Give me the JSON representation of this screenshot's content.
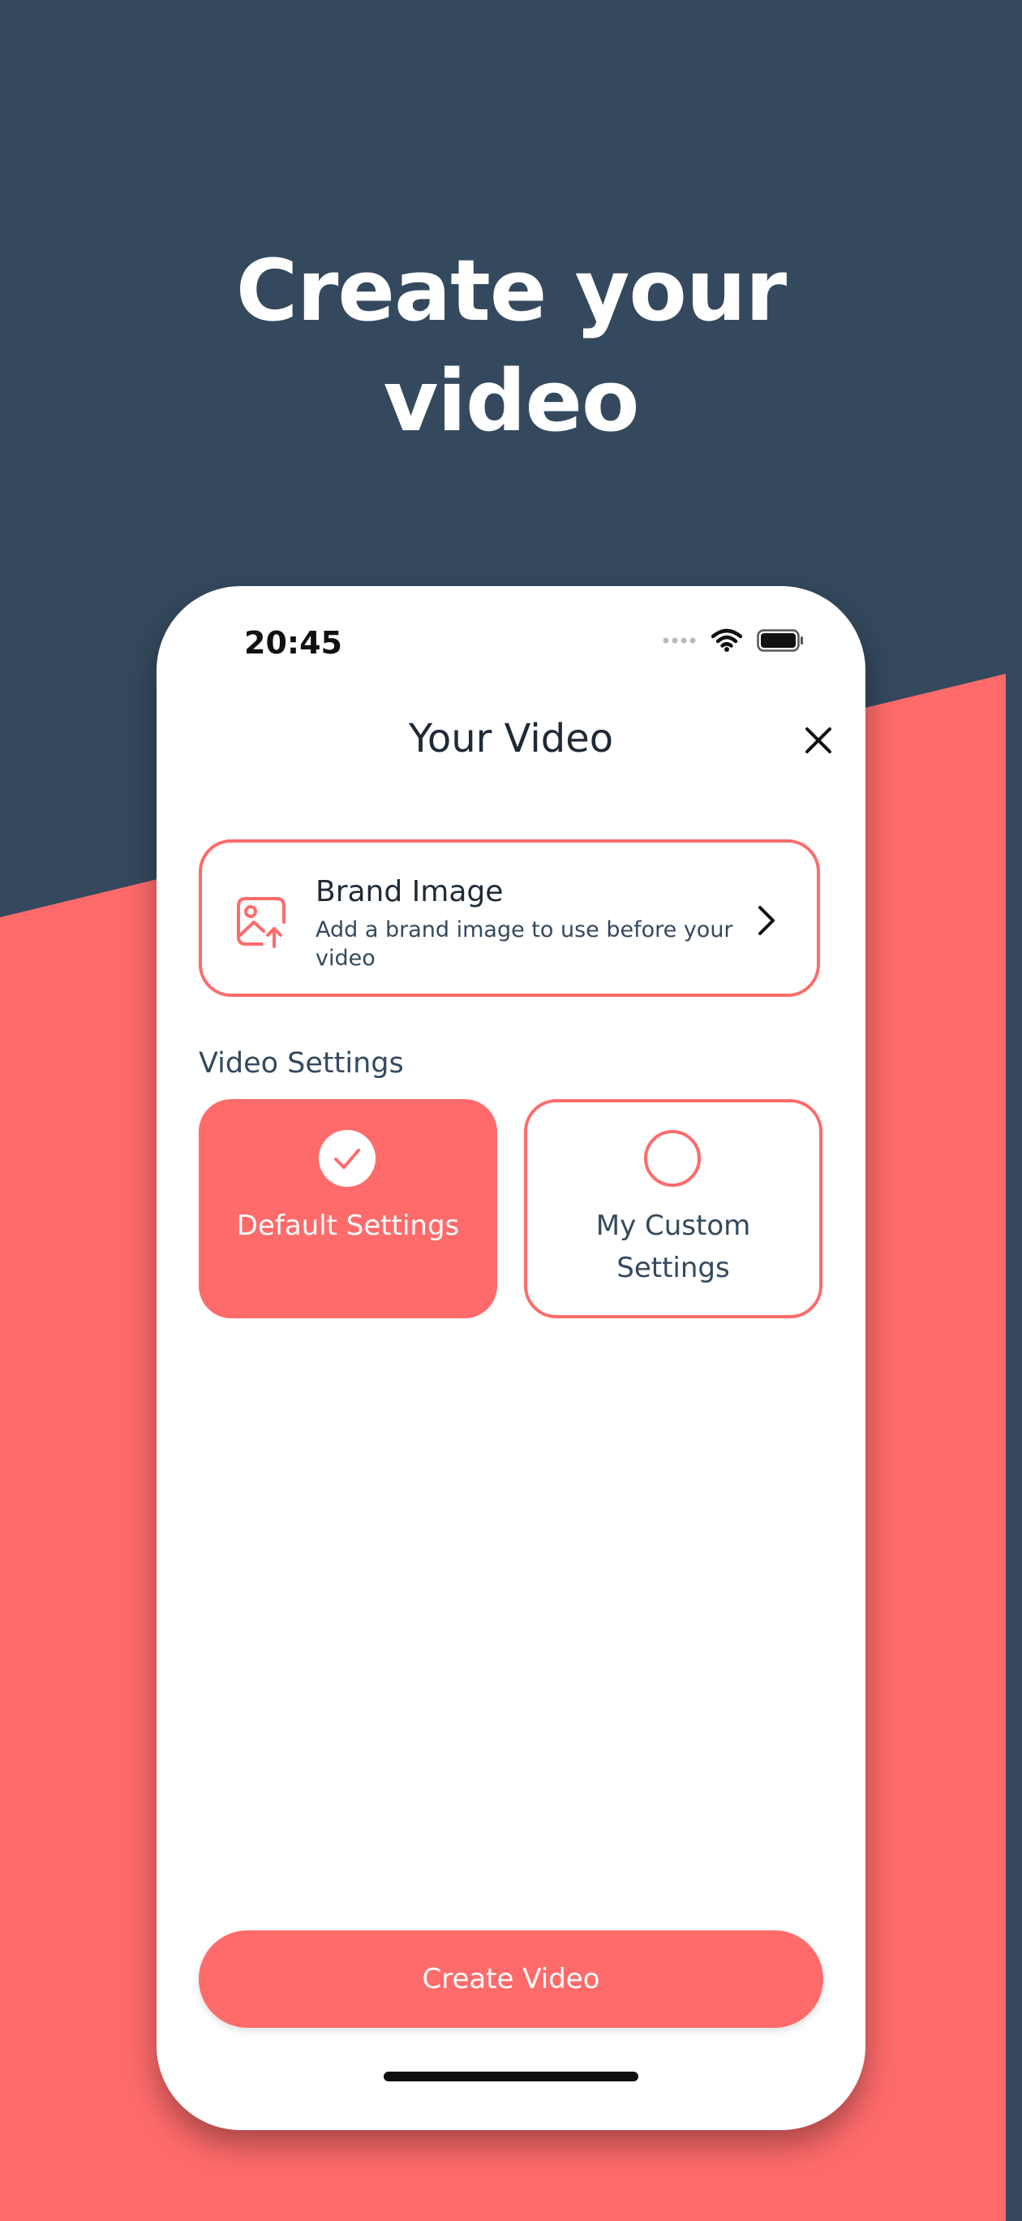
{
  "colors": {
    "navy": "#34495e",
    "coral": "#ff6b6b",
    "white": "#ffffff",
    "dark_text": "#1f2a36"
  },
  "headline": {
    "line1": "Create your",
    "line2": "video"
  },
  "status_bar": {
    "time": "20:45",
    "icons": [
      "cellular-dots-icon",
      "wifi-icon",
      "battery-icon"
    ]
  },
  "nav": {
    "title": "Your Video",
    "close_icon": "close-icon"
  },
  "brand_image": {
    "icon": "image-upload-icon",
    "title": "Brand Image",
    "subtitle": "Add a brand image to use before your video",
    "chevron_icon": "chevron-right-icon"
  },
  "video_settings": {
    "label": "Video Settings",
    "options": [
      {
        "label": "Default Settings",
        "selected": true
      },
      {
        "label_line1": "My Custom",
        "label_line2": "Settings",
        "selected": false
      }
    ]
  },
  "actions": {
    "create_label": "Create Video"
  }
}
